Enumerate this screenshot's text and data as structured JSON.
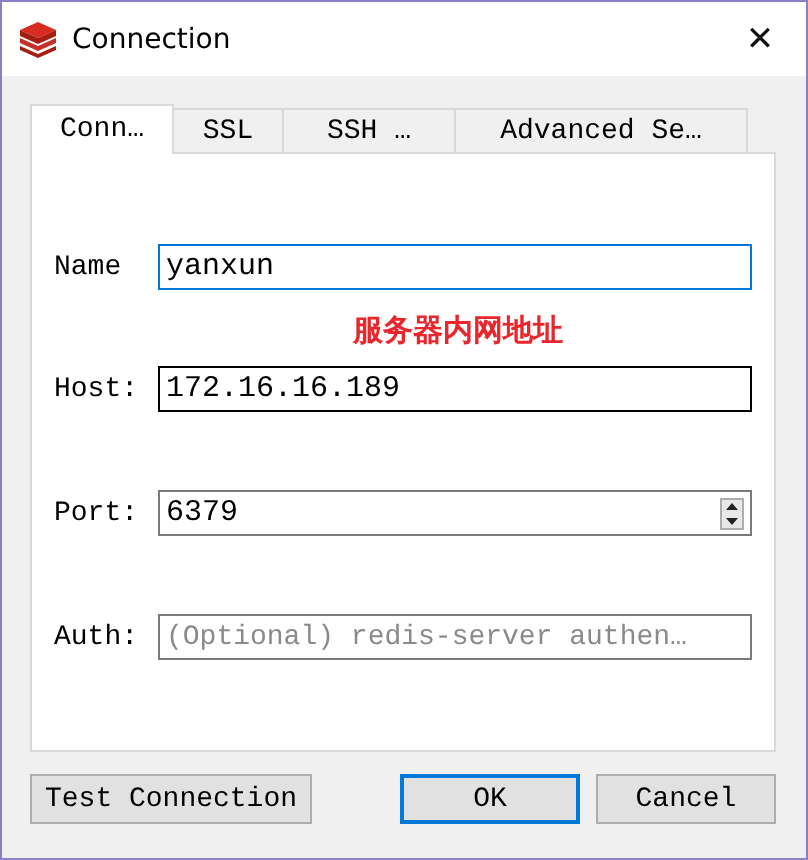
{
  "window": {
    "title": "Connection",
    "close": "✕"
  },
  "tabs": [
    {
      "label": "Conn…",
      "selected": true
    },
    {
      "label": "SSL",
      "selected": false
    },
    {
      "label": "SSH …",
      "selected": false
    },
    {
      "label": "Advanced Se…",
      "selected": false
    }
  ],
  "fields": [
    {
      "kind": "text",
      "label": "Name",
      "value": "yanxun",
      "focused": true,
      "hovered": false
    },
    {
      "kind": "note",
      "text": "服务器内网地址"
    },
    {
      "kind": "text",
      "label": "Host:",
      "value": "172.16.16.189",
      "focused": false,
      "hovered": true
    },
    {
      "kind": "spin",
      "label": "Port:",
      "value": "6379",
      "focused": false,
      "hovered": false
    },
    {
      "kind": "text",
      "label": "Auth:",
      "placeholder": "(Optional) redis-server authen…",
      "focused": false,
      "hovered": false
    }
  ],
  "buttons": [
    {
      "label": "Test Connection",
      "default": false
    },
    {
      "label": "OK",
      "default": true
    },
    {
      "label": "Cancel",
      "default": false
    }
  ]
}
